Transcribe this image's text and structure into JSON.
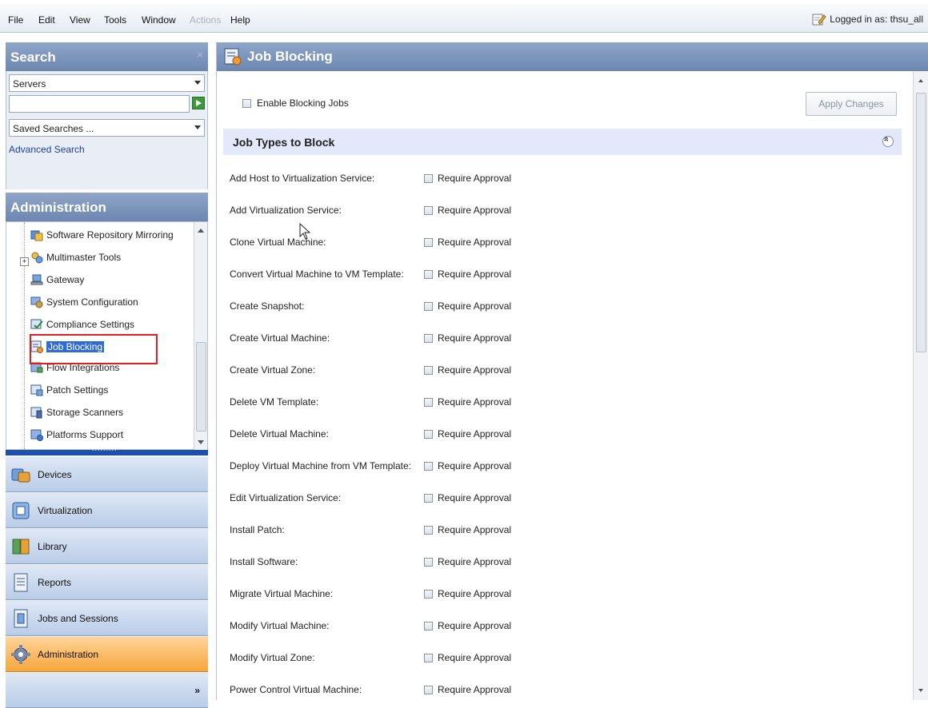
{
  "menu": {
    "items": [
      "File",
      "Edit",
      "View",
      "Tools",
      "Window",
      "Actions",
      "Help"
    ],
    "login_text": "Logged in as: thsu_all"
  },
  "search": {
    "title": "Search",
    "close_glyph": "×",
    "scope_value": "Servers",
    "query_value": "",
    "saved_value": "Saved Searches ...",
    "advanced_link": "Advanced Search"
  },
  "administration": {
    "title": "Administration",
    "tree": [
      {
        "label": "Software Repository Mirroring",
        "icon": "repository-mirroring-icon"
      },
      {
        "label": "Multimaster Tools",
        "icon": "multimaster-tools-icon",
        "expandable": true
      },
      {
        "label": "Gateway",
        "icon": "gateway-icon"
      },
      {
        "label": "System Configuration",
        "icon": "system-configuration-icon"
      },
      {
        "label": "Compliance Settings",
        "icon": "compliance-settings-icon"
      },
      {
        "label": "Job Blocking",
        "icon": "job-blocking-icon",
        "selected": true
      },
      {
        "label": "Flow Integrations",
        "icon": "flow-integrations-icon"
      },
      {
        "label": "Patch Settings",
        "icon": "patch-settings-icon"
      },
      {
        "label": "Storage Scanners",
        "icon": "storage-scanners-icon"
      },
      {
        "label": "Platforms Support",
        "icon": "platforms-support-icon"
      }
    ],
    "highlight_color": "#e02020"
  },
  "nav": {
    "buttons": [
      {
        "label": "Devices",
        "icon": "devices-icon"
      },
      {
        "label": "Virtualization",
        "icon": "virtualization-icon"
      },
      {
        "label": "Library",
        "icon": "library-icon"
      },
      {
        "label": "Reports",
        "icon": "reports-icon"
      },
      {
        "label": "Jobs and Sessions",
        "icon": "jobs-sessions-icon"
      },
      {
        "label": "Administration",
        "icon": "administration-icon",
        "active": true
      }
    ],
    "more_glyph": "»",
    "active_color": "#f6a63a"
  },
  "main": {
    "title": "Job Blocking",
    "enable_label": "Enable Blocking Jobs",
    "enable_checked": false,
    "apply_label": "Apply Changes",
    "section_title": "Job Types to Block",
    "checkbox_label": "Require Approval",
    "jobs": [
      "Add Host to Virtualization Service:",
      "Add Virtualization Service:",
      "Clone Virtual Machine:",
      "Convert Virtual Machine to VM Template:",
      "Create Snapshot:",
      "Create Virtual Machine:",
      "Create Virtual Zone:",
      "Delete VM Template:",
      "Delete Virtual Machine:",
      "Deploy Virtual Machine from VM Template:",
      "Edit Virtualization Service:",
      "Install Patch:",
      "Install Software:",
      "Migrate Virtual Machine:",
      "Modify Virtual Machine:",
      "Modify Virtual Zone:",
      "Power Control Virtual Machine:"
    ]
  }
}
